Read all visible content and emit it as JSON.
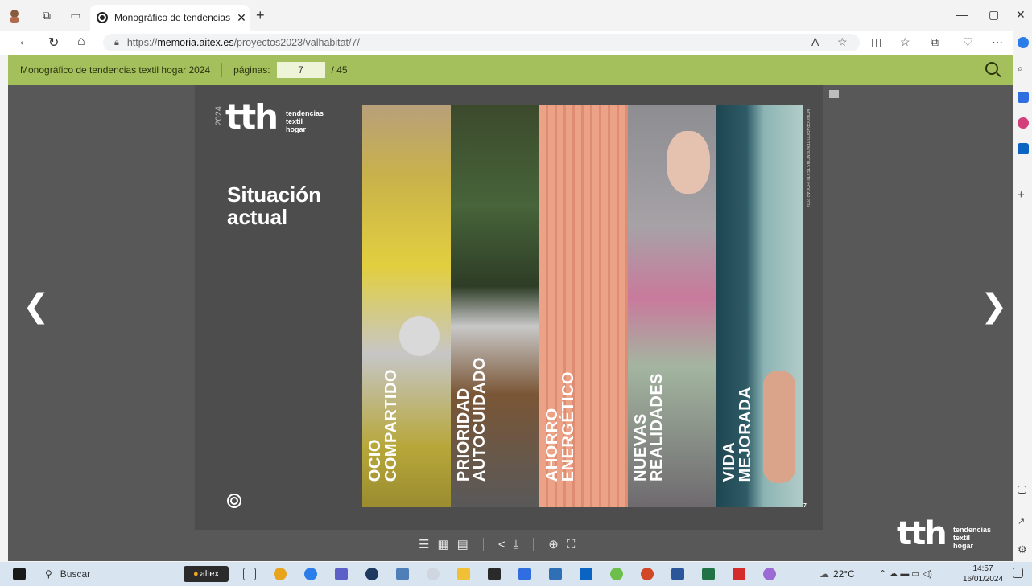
{
  "browser": {
    "tab_title": "Monográfico de tendencias textil",
    "url_prefix": "https://",
    "url_host": "memoria.aitex.es",
    "url_path": "/proyectos2023/valhabitat/7/"
  },
  "viewer": {
    "doc_title": "Monográfico de tendencias textil hogar 2024",
    "pages_label": "páginas:",
    "current_page": "7",
    "total_pages": "/ 45"
  },
  "page": {
    "logo_main": "tth",
    "logo_year": "2024",
    "logo_words": [
      "tendencias",
      "textil",
      "hogar"
    ],
    "heading_line1": "Situación",
    "heading_line2": "actual",
    "side_caption": "MONOGRÁFICO TENDENCIAS TEXTIL HOGAR 2024",
    "page_mark": "7",
    "stripes": [
      {
        "label": "OCIO\nCOMPARTIDO",
        "color": "#d8c437"
      },
      {
        "label": "PRIORIDAD\nAUTOCUIDADO",
        "color": "#4f5b3e"
      },
      {
        "label": "AHORRO\nENERGÉTICO",
        "color": "#e99b7f"
      },
      {
        "label": "NUEVAS\nREALIDADES",
        "color": "#8e8a8e"
      },
      {
        "label": "VIDA\nMEJORADA",
        "color": "#5f8d93"
      }
    ]
  },
  "footer_logo": {
    "main": "tth",
    "words": [
      "tendencias",
      "textil",
      "hogar"
    ]
  },
  "taskbar": {
    "search_placeholder": "Buscar",
    "app_chip": "altex",
    "weather": "22°C",
    "time": "14:57",
    "date": "16/01/2024"
  }
}
